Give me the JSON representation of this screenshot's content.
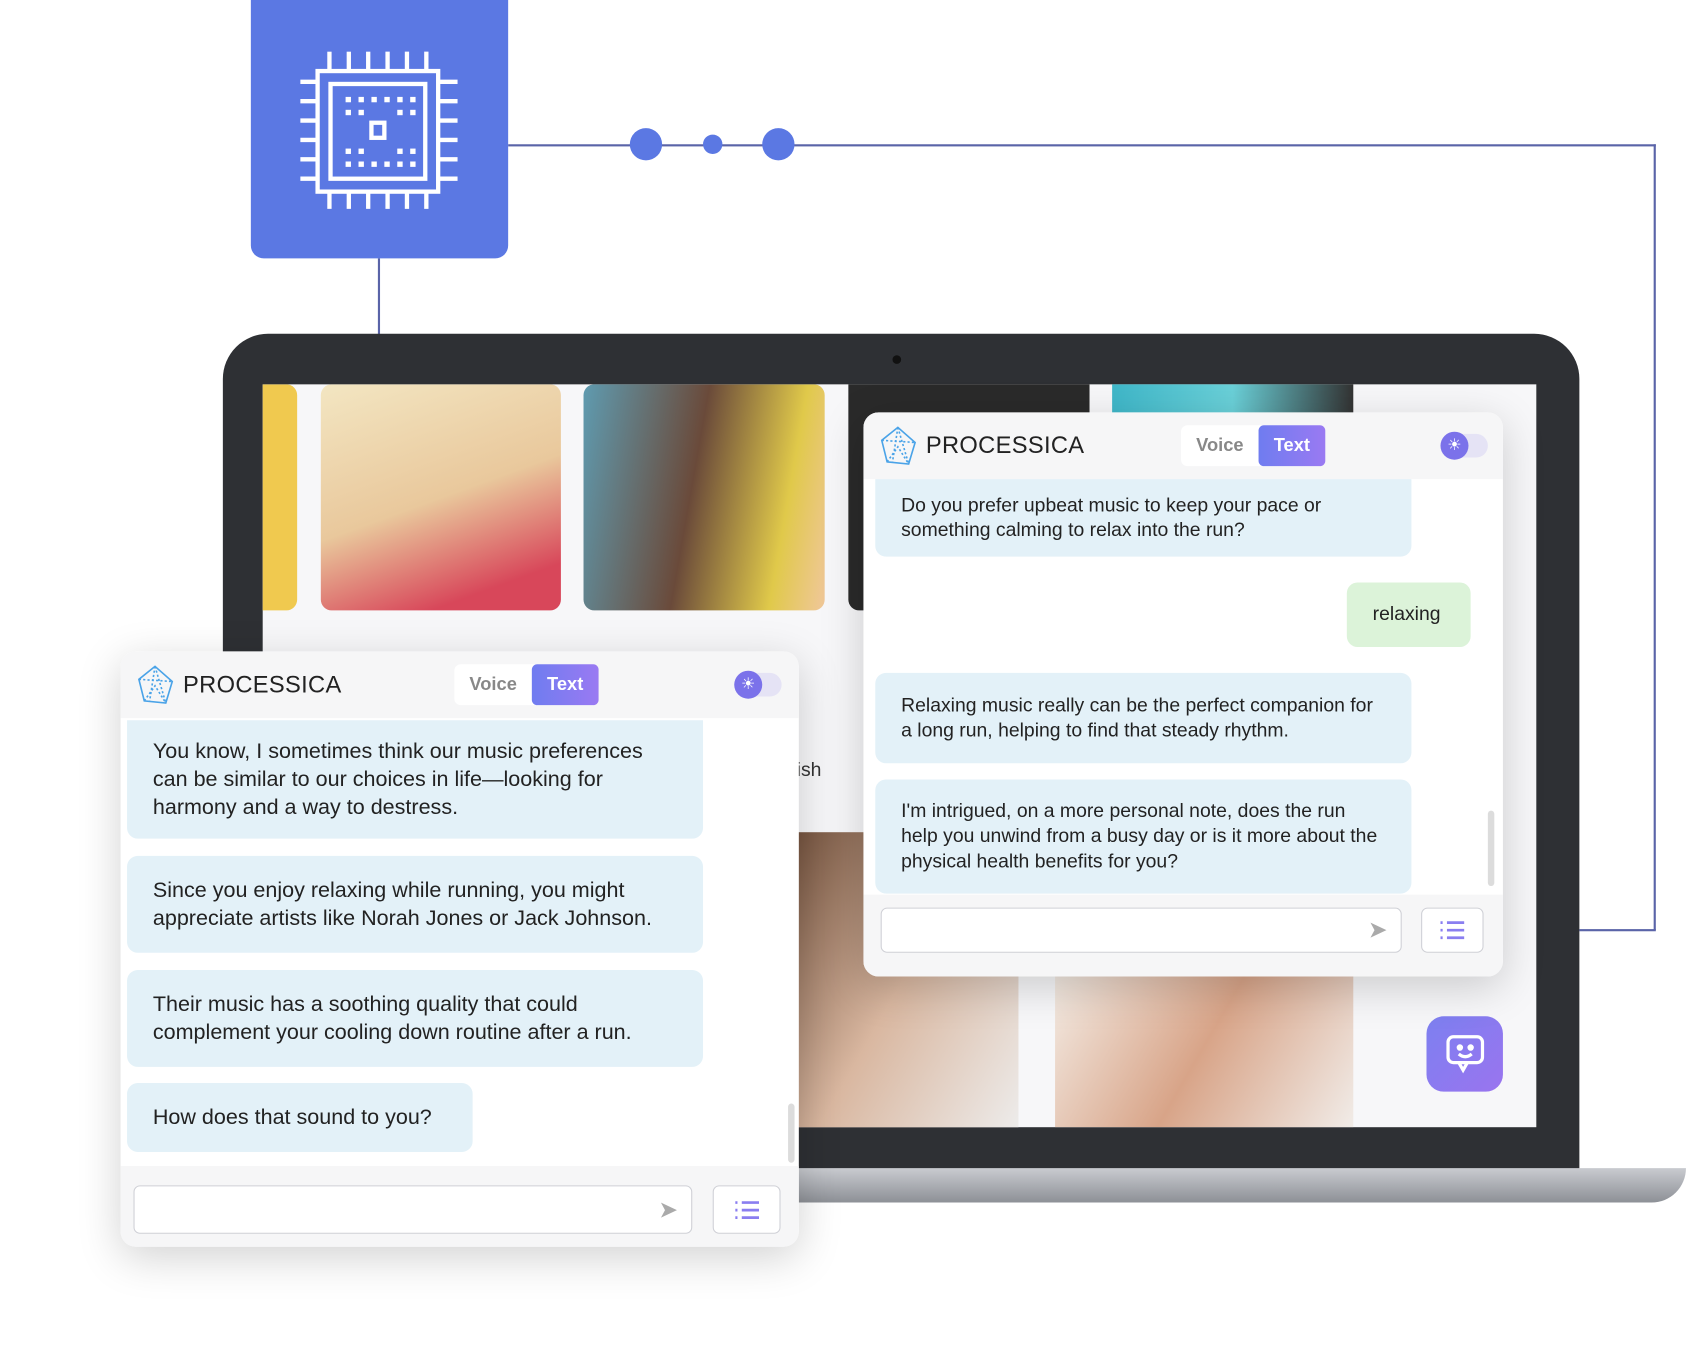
{
  "colors": {
    "accent": "#5b78e3",
    "purple": "#7b72ea",
    "bot_bubble": "#e3f1f8",
    "user_bubble": "#dcf3d9"
  },
  "icons": {
    "cpu": "cpu-chip-icon",
    "logo": "polyhedron-logo-icon",
    "theme": "sun-icon",
    "send": "send-arrow-icon",
    "menu": "list-icon",
    "chat": "chat-face-icon"
  },
  "background_text": "ish",
  "right_panel": {
    "brand": "PROCESSICA",
    "mode_voice": "Voice",
    "mode_text": "Text",
    "active_mode": "Text",
    "messages": [
      {
        "role": "bot",
        "text": "Do you prefer upbeat music to keep your pace or something calming to relax into the run?"
      },
      {
        "role": "user",
        "text": "relaxing"
      },
      {
        "role": "bot",
        "text": "Relaxing music really can be the perfect companion for a long run, helping to find that steady rhythm."
      },
      {
        "role": "bot",
        "text": "I'm intrigued, on a more personal note, does the run help you unwind from a busy day or is it more about the physical health benefits for you?"
      }
    ],
    "input_value": ""
  },
  "left_panel": {
    "brand": "PROCESSICA",
    "mode_voice": "Voice",
    "mode_text": "Text",
    "active_mode": "Text",
    "messages": [
      {
        "role": "bot",
        "text": "You know, I sometimes think our music preferences can be similar to our choices in life—looking for harmony and a way to destress."
      },
      {
        "role": "bot",
        "text": "Since you enjoy relaxing while running, you might appreciate artists like Norah Jones or Jack Johnson."
      },
      {
        "role": "bot",
        "text": "Their music has a soothing quality that could complement your cooling down routine after a run."
      },
      {
        "role": "bot",
        "text": "How does that sound to you?"
      }
    ],
    "input_value": ""
  }
}
